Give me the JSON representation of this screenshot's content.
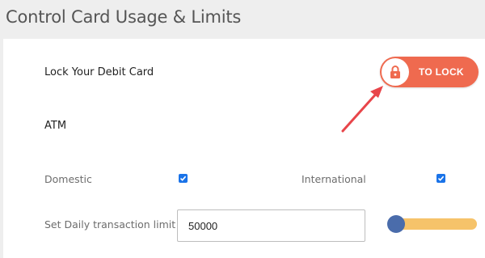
{
  "header": {
    "title": "Control Card Usage & Limits"
  },
  "lock_card": {
    "label": "Lock Your Debit Card",
    "button_label": "TO LOCK",
    "icon": "lock-icon"
  },
  "atm": {
    "label": "ATM"
  },
  "domestic": {
    "label": "Domestic",
    "checked": true
  },
  "international": {
    "label": "International",
    "checked": true
  },
  "daily_limit": {
    "label": "Set Daily transaction limit",
    "value": "50000",
    "slider_fraction": 0.0
  },
  "colors": {
    "lock_button": "#ef6a4f",
    "checkbox": "#1a73e8",
    "slider_track": "#f6c36a",
    "slider_thumb": "#4a6cab",
    "arrow": "#e8454a"
  }
}
